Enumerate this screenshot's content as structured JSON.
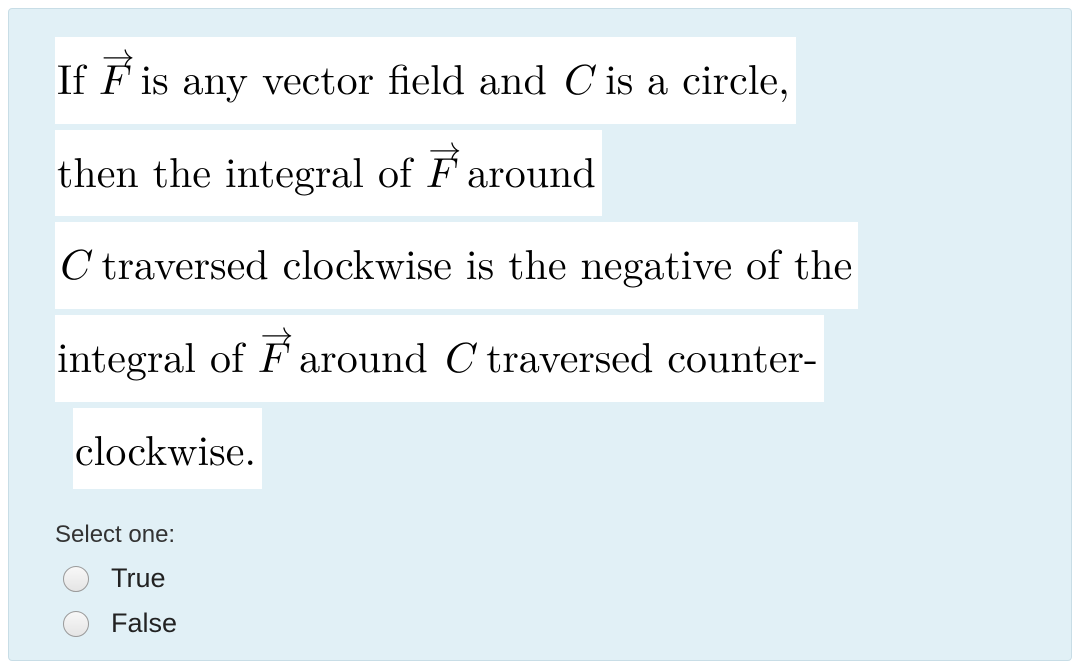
{
  "question": {
    "lines": [
      {
        "pre": "If ",
        "vec": "F",
        "post": " is any vector field and ",
        "italic": "C",
        "tail": " is a circle,"
      },
      {
        "pre": "then the integral of ",
        "vec": "F",
        "post": " around"
      },
      {
        "italicPre": "C",
        "plain": " traversed clockwise is the negative of the"
      },
      {
        "pre": "integral of ",
        "vec": "F",
        "post": " around ",
        "italic": "C",
        "tail": " traversed counter-"
      },
      {
        "plain": "clockwise.",
        "indent": true
      }
    ]
  },
  "answers": {
    "prompt": "Select one:",
    "options": [
      {
        "id": "opt-true",
        "label": "True"
      },
      {
        "id": "opt-false",
        "label": "False"
      }
    ]
  }
}
